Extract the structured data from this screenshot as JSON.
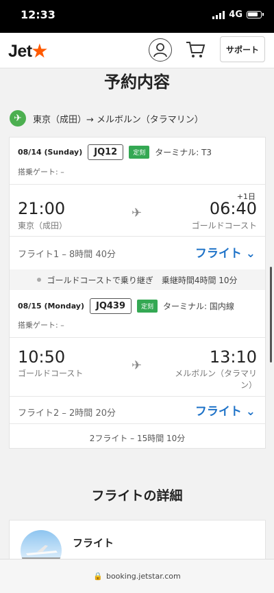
{
  "status": {
    "time": "12:33",
    "network": "4G"
  },
  "header": {
    "logo_text": "Jet",
    "logo_star": "★",
    "account_icon": "person-icon",
    "cart_icon": "cart-icon",
    "support_label": "サポート"
  },
  "page": {
    "title": "予約内容",
    "route": "東京（成田）→ メルボルン（タラマリン）"
  },
  "segments": [
    {
      "date": "08/14 (Sunday)",
      "flight_no": "JQ12",
      "badge": "定刻",
      "terminal": "ターミナル: T3",
      "gate": "搭乗ゲート: –",
      "dep_time": "21:00",
      "dep_city": "東京（成田）",
      "arr_time": "06:40",
      "arr_city": "ゴールドコースト",
      "day_offset": "+1日",
      "duration": "フライト1 – 8時間 40分",
      "link": "フライト ⌄"
    },
    {
      "date": "08/15 (Monday)",
      "flight_no": "JQ439",
      "badge": "定刻",
      "terminal": "ターミナル: 国内線",
      "gate": "搭乗ゲート: –",
      "dep_time": "10:50",
      "dep_city": "ゴールドコースト",
      "arr_time": "13:10",
      "arr_city": "メルボルン（タラマリン）",
      "duration": "フライト2 – 2時間 20分",
      "link": "フライト ⌄"
    }
  ],
  "connection": "ゴールドコーストで乗り継ぎ　乗継時間4時間 10分",
  "total": "2フライト – 15時間 10分",
  "details": {
    "title": "フライトの詳細",
    "card_label": "フライト"
  },
  "url": "booking.jetstar.com",
  "colors": {
    "accent": "#ff5a00",
    "link": "#1f73c8",
    "badge": "#34a853"
  }
}
